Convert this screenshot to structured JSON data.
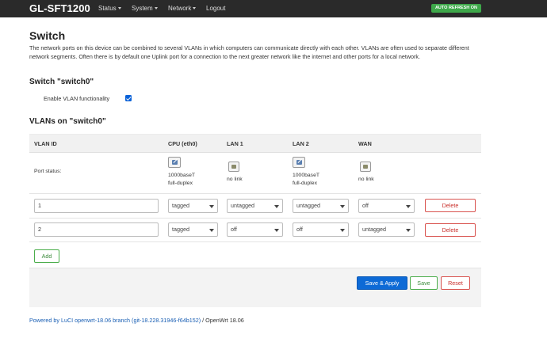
{
  "header": {
    "brand": "GL-SFT1200",
    "menu": [
      "Status",
      "System",
      "Network",
      "Logout"
    ],
    "badge": "AUTO REFRESH ON"
  },
  "page": {
    "title": "Switch",
    "description": "The network ports on this device can be combined to several VLANs in which computers can communicate directly with each other. VLANs are often used to separate different network segments. Often there is by default one Uplink port for a connection to the next greater network like the internet and other ports for a local network."
  },
  "switch_section": {
    "title": "Switch \"switch0\"",
    "enable_vlan_label": "Enable VLAN functionality",
    "enable_vlan_checked": true
  },
  "vlans": {
    "title": "VLANs on \"switch0\"",
    "columns": [
      "VLAN ID",
      "CPU (eth0)",
      "LAN 1",
      "LAN 2",
      "WAN"
    ],
    "port_status_label": "Port status:",
    "port_status": [
      {
        "line1": "1000baseT",
        "line2": "full-duplex",
        "icon": "port-linked-icon"
      },
      {
        "line1": "no link",
        "line2": "",
        "icon": "port-nolink-icon"
      },
      {
        "line1": "1000baseT",
        "line2": "full-duplex",
        "icon": "port-linked-icon"
      },
      {
        "line1": "no link",
        "line2": "",
        "icon": "port-nolink-icon"
      }
    ],
    "rows": [
      {
        "vlan_id": "1",
        "cpu": "tagged",
        "lan1": "untagged",
        "lan2": "untagged",
        "wan": "off"
      },
      {
        "vlan_id": "2",
        "cpu": "tagged",
        "lan1": "off",
        "lan2": "off",
        "wan": "untagged"
      }
    ],
    "delete_label": "Delete",
    "add_label": "Add"
  },
  "actions": {
    "save_apply": "Save & Apply",
    "save": "Save",
    "reset": "Reset"
  },
  "footer": {
    "link_text": "Powered by LuCI openwrt-18.06 branch (git-18.228.31946-f64b152)",
    "suffix": " / OpenWrt 18.06"
  },
  "colors": {
    "navbar": "#2a2a2a",
    "badge": "#3ea84a",
    "primary": "#0d6ad6",
    "success": "#4cae4c",
    "danger": "#d9534f",
    "link": "#1a5fb4"
  }
}
